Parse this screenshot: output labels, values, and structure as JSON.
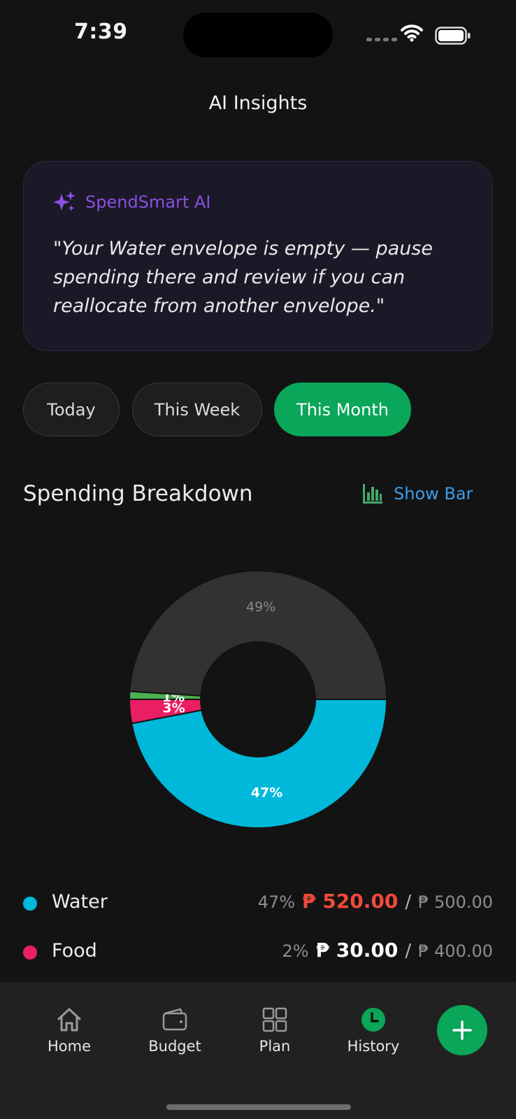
{
  "status_bar": {
    "time": "7:39"
  },
  "header": {
    "title": "AI Insights"
  },
  "ai_card": {
    "name": "SpendSmart AI",
    "quote": "\"Your Water envelope is empty — pause spending there and review if you can reallocate from another envelope.\"",
    "accent": "#8a4fe0"
  },
  "filters": [
    {
      "label": "Today",
      "active": false
    },
    {
      "label": "This Week",
      "active": false
    },
    {
      "label": "This Month",
      "active": true
    }
  ],
  "section": {
    "title": "Spending Breakdown",
    "toggle_label": "Show Bar"
  },
  "chart_data": {
    "type": "pie",
    "variant": "donut",
    "slices": [
      {
        "label": "Water",
        "percent": 47,
        "color": "#00b8d9",
        "text": "47%"
      },
      {
        "label": "Food",
        "percent": 3,
        "color": "#e91e63",
        "text": "3%"
      },
      {
        "label": "",
        "percent": 1,
        "color": "#4caf50",
        "text": "1%"
      },
      {
        "label": "",
        "percent": 49,
        "color": "#323232",
        "text": "49%"
      }
    ]
  },
  "legend": [
    {
      "name": "Water",
      "color": "#00b8d9",
      "percent": "47%",
      "spent": "₱ 520.00",
      "spent_color": "#f04a3a",
      "sep": "/",
      "budget": "₱ 500.00"
    },
    {
      "name": "Food",
      "color": "#e91e63",
      "percent": "2%",
      "spent": "₱ 30.00",
      "spent_color": "#ffffff",
      "sep": "/",
      "budget": "₱ 400.00"
    }
  ],
  "tabbar": {
    "items": [
      {
        "label": "Home",
        "icon": "home-icon"
      },
      {
        "label": "Budget",
        "icon": "wallet-icon"
      },
      {
        "label": "Plan",
        "icon": "grid-icon"
      },
      {
        "label": "History",
        "icon": "clock-icon"
      }
    ],
    "fab_icon": "plus-icon",
    "accent": "#0aa659"
  }
}
